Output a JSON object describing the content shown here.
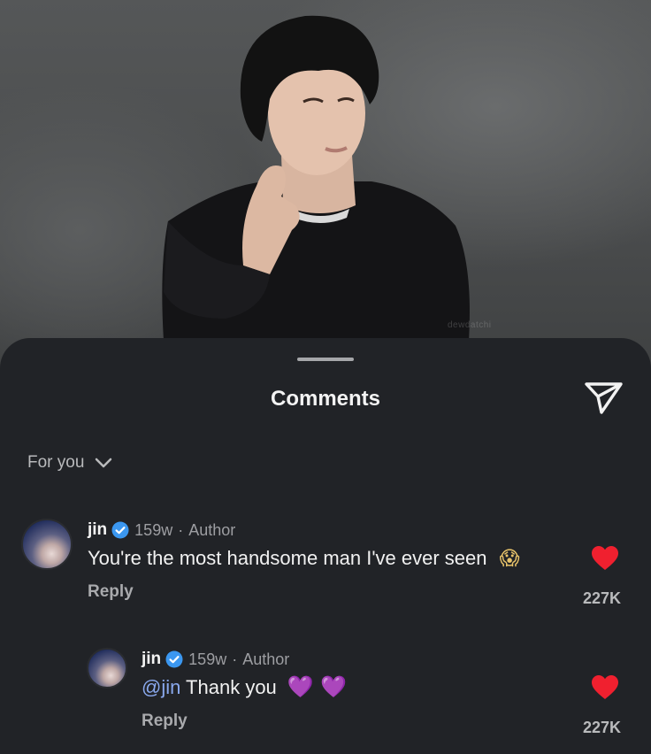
{
  "sheet": {
    "title": "Comments",
    "filter_label": "For you",
    "icons": {
      "send": "send-icon",
      "chevron": "chevron-down-icon"
    }
  },
  "photo": {
    "watermark": "dewdatchi"
  },
  "comments": [
    {
      "username": "jin",
      "time": "159w",
      "separator": "·",
      "badge": "Author",
      "text": "You're the most handsome man I've ever seen",
      "emoji": "😱",
      "reply_label": "Reply",
      "likes": "227K"
    },
    {
      "username": "jin",
      "time": "159w",
      "separator": "·",
      "badge": "Author",
      "mention": "@jin",
      "text": " Thank you",
      "emoji_hearts": "💜 💜",
      "reply_label": "Reply",
      "likes": "227K"
    }
  ],
  "colors": {
    "sheet_bg": "#212327",
    "verified_blue": "#3b97f0",
    "heart_red": "#f0202f",
    "mention_blue": "#8aa9ee"
  }
}
